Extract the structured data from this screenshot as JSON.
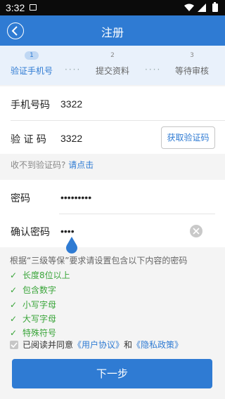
{
  "status_bar": {
    "time": "3:32"
  },
  "header": {
    "title": "注册"
  },
  "steps": [
    {
      "num": "1",
      "label": "验证手机号"
    },
    {
      "num": "2",
      "label": "提交资料"
    },
    {
      "num": "3",
      "label": "等待审核"
    }
  ],
  "step_separator": "····",
  "form": {
    "phone": {
      "label": "手机号码",
      "value": "3322"
    },
    "code": {
      "label": "验 证 码",
      "value": "3322",
      "button": "获取验证码"
    },
    "hint": {
      "text": "收不到验证码?",
      "link": "请点击"
    },
    "password": {
      "label": "密码",
      "value": "•••••••••"
    },
    "confirm": {
      "label": "确认密码",
      "value": "••••"
    }
  },
  "rules": {
    "title": "根据“三级等保”要求请设置包含以下内容的密码",
    "items": [
      "长度8位以上",
      "包含数字",
      "小写字母",
      "大写字母",
      "特殊符号"
    ]
  },
  "agreement": {
    "text": "已阅读并同意",
    "link1": "《用户协议》",
    "and": "和",
    "link2": "《隐私政策》"
  },
  "next_button": "下一步",
  "colors": {
    "primary": "#2f7bd3",
    "success": "#3aa53a"
  }
}
